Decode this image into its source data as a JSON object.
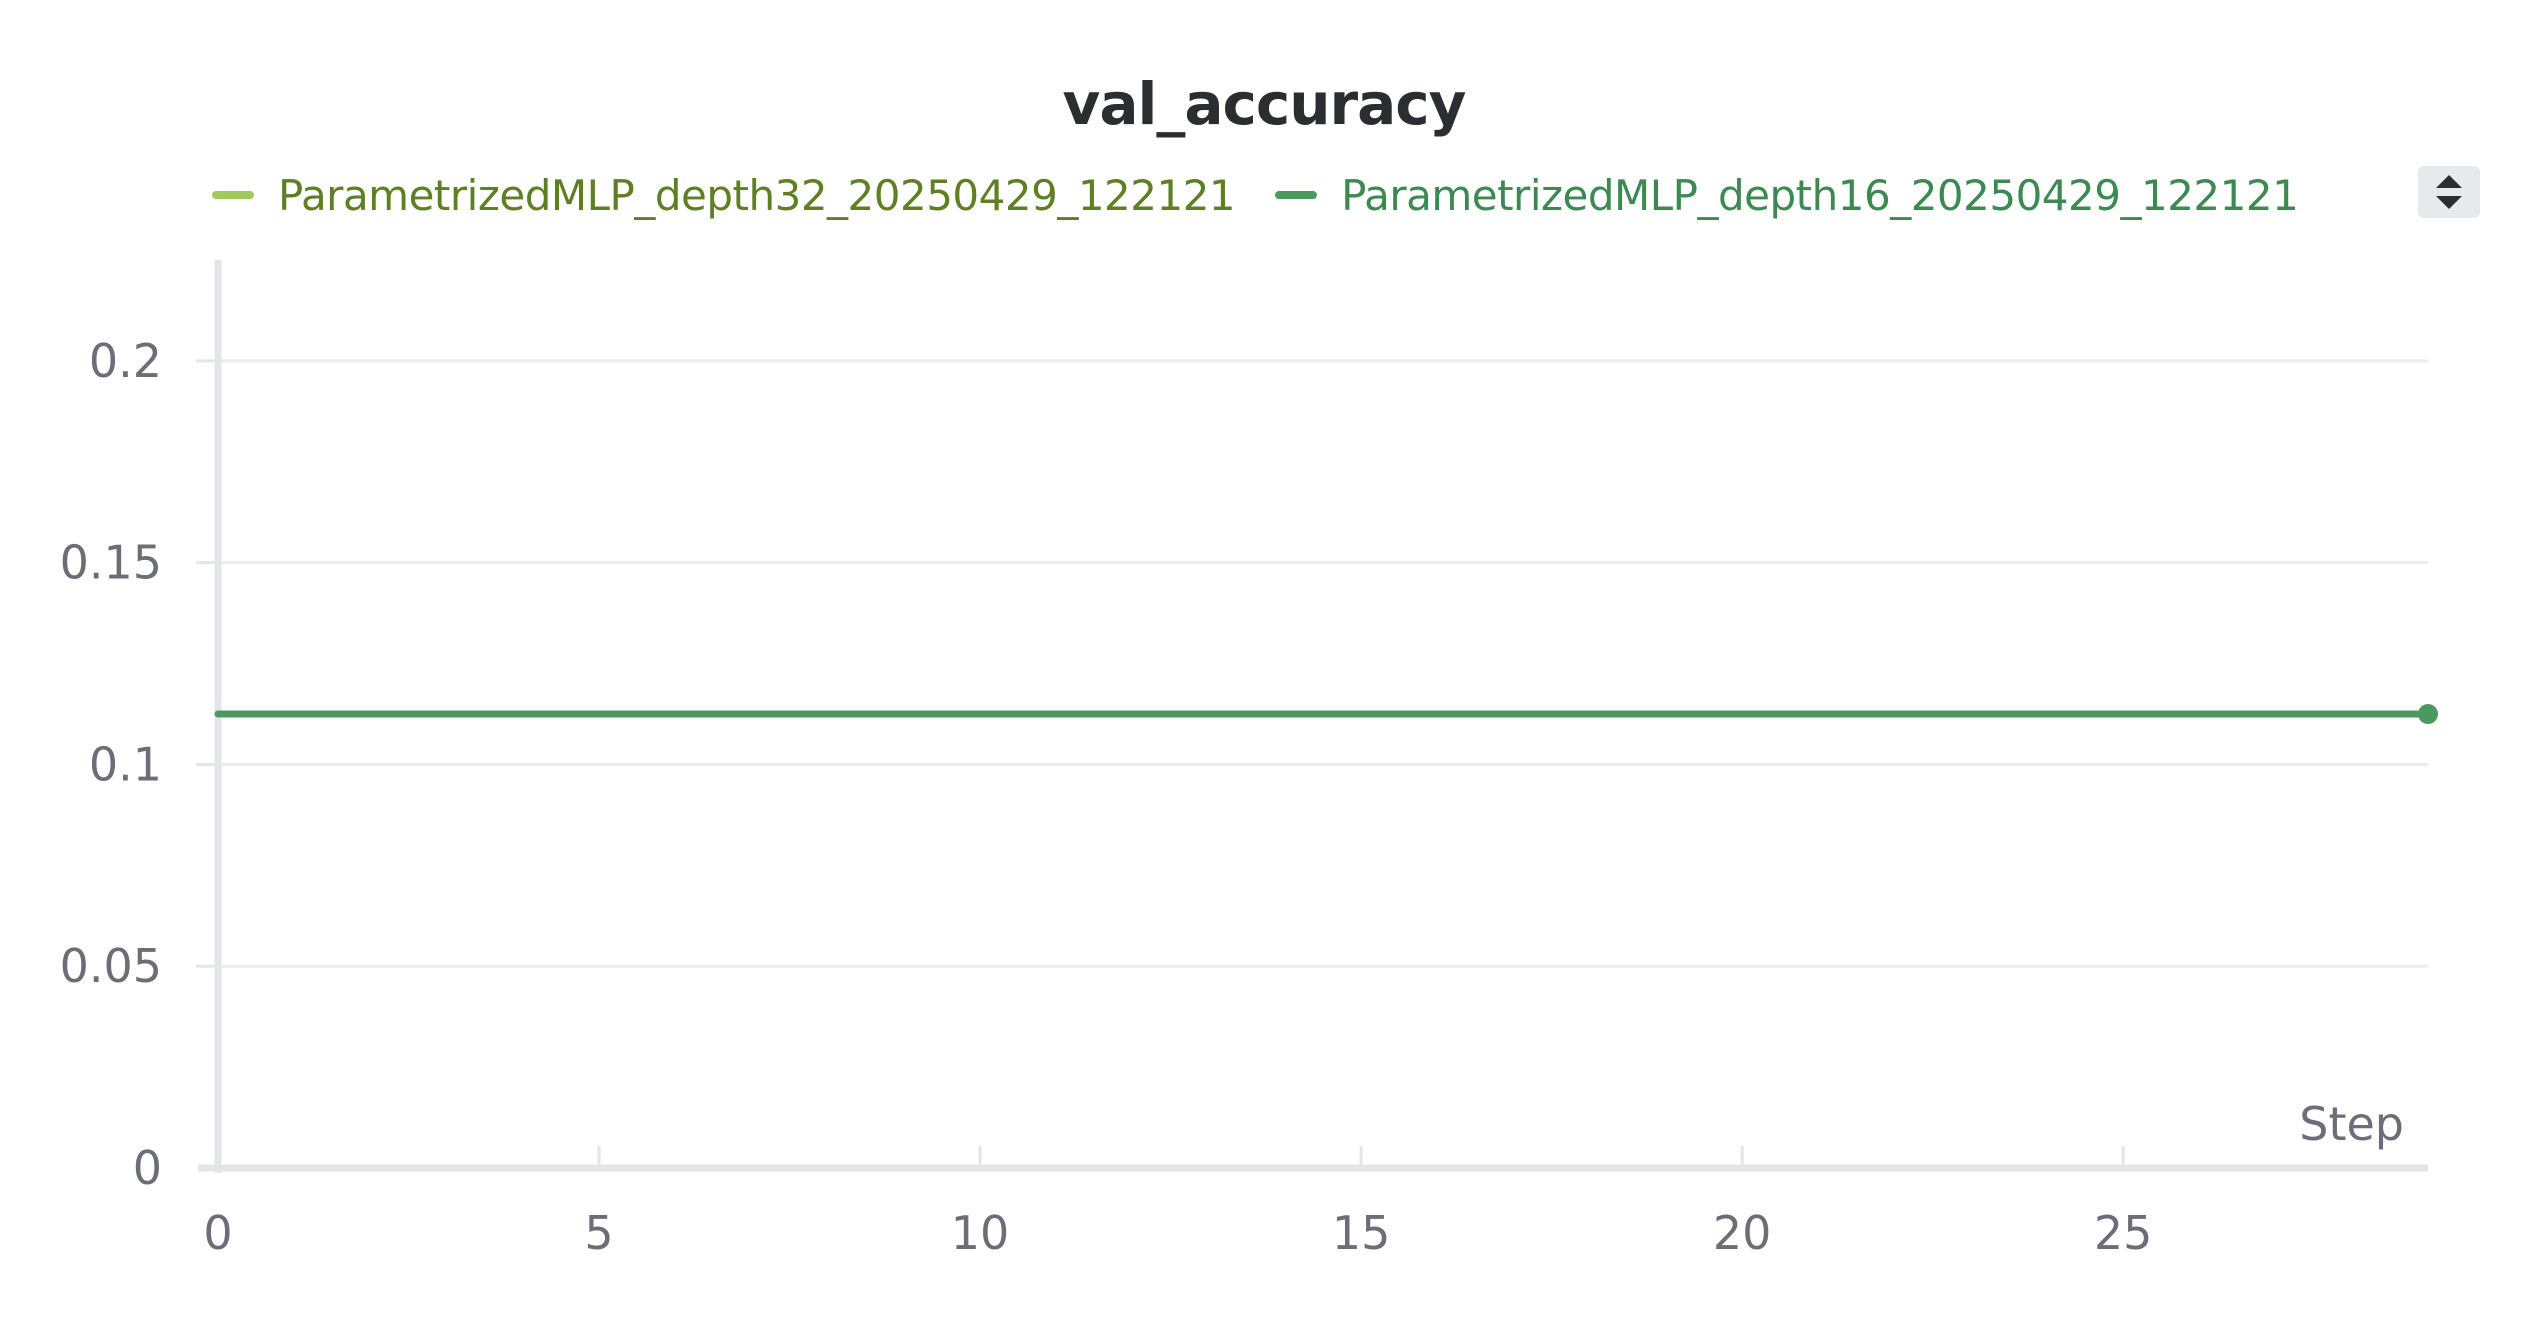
{
  "chart_data": {
    "type": "line",
    "title": "val_accuracy",
    "xlabel": "Step",
    "ylabel": "",
    "xlim": [
      0,
      29
    ],
    "ylim": [
      0,
      0.225
    ],
    "xticks": [
      0,
      5,
      10,
      15,
      20,
      25
    ],
    "xtick_labels": [
      "0",
      "5",
      "10",
      "15",
      "20",
      "25"
    ],
    "yticks": [
      0,
      0.05,
      0.1,
      0.15,
      0.2
    ],
    "ytick_labels": [
      "0",
      "0.05",
      "0.1",
      "0.15",
      "0.2"
    ],
    "grid": true,
    "legend_position": "top",
    "series": [
      {
        "name": "ParametrizedMLP_depth32_20250429_122121",
        "color": "#9fcb5b",
        "label_color": "#5e7f22",
        "x": [],
        "y": []
      },
      {
        "name": "ParametrizedMLP_depth16_20250429_122121",
        "color": "#4a9a5f",
        "label_color": "#3c8a52",
        "x": [
          0,
          29
        ],
        "y": [
          0.1125,
          0.1125
        ],
        "end_marker": true
      }
    ]
  },
  "legend_toggle_icon": "sort-toggle-icon"
}
